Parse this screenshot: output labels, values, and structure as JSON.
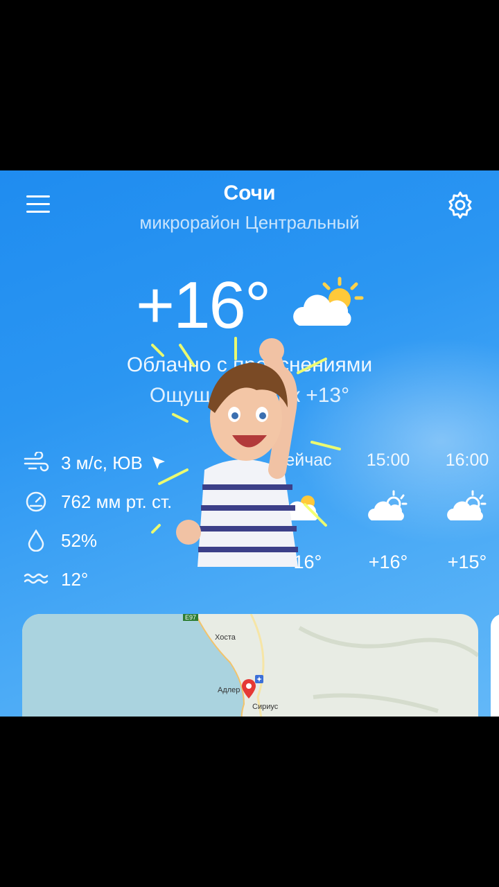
{
  "header": {
    "city": "Сочи",
    "district": "микрорайон Центральный"
  },
  "current": {
    "temperature": "+16°",
    "condition": "Облачно с прояснениями",
    "feels_like": "Ощущается как +13°",
    "icon": "partly-cloudy-icon"
  },
  "details": {
    "wind": "3 м/с, ЮВ",
    "pressure": "762 мм рт. ст.",
    "humidity": "52%",
    "water_temp": "12°"
  },
  "hourly": [
    {
      "time": "Сейчас",
      "temp": "+16°",
      "icon": "partly-cloudy-icon"
    },
    {
      "time": "15:00",
      "temp": "+16°",
      "icon": "partly-cloudy-icon"
    },
    {
      "time": "16:00",
      "temp": "+15°",
      "icon": "partly-cloudy-icon"
    }
  ],
  "map": {
    "labels": [
      "Хоста",
      "Адлер",
      "Сириус"
    ],
    "road_badge": "E97"
  },
  "colors": {
    "background_top": "#1f8cf0",
    "background_bottom": "#63b8f8",
    "text": "#ffffff",
    "pin": "#e53935"
  }
}
